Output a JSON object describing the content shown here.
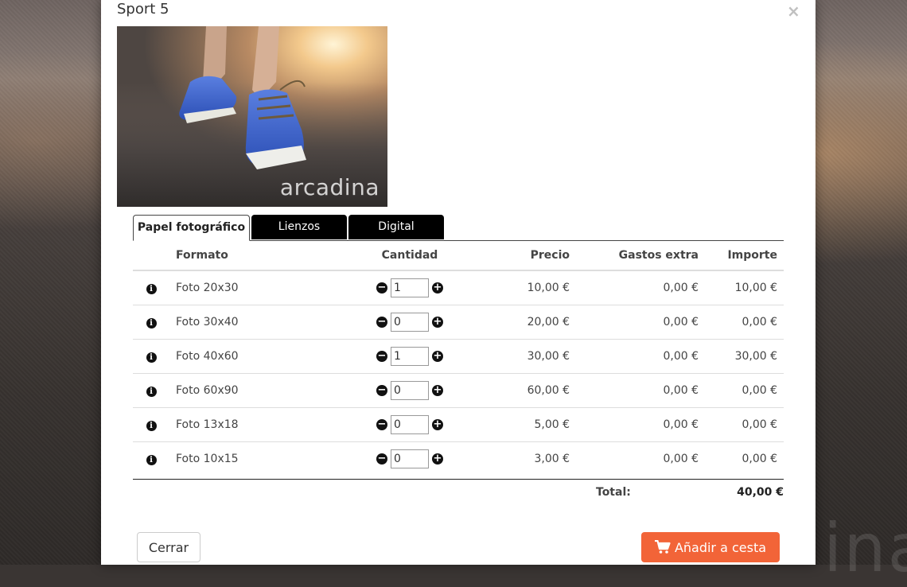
{
  "modal": {
    "title": "Sport 5",
    "close_icon": "close-icon",
    "close_glyph": "×",
    "photo_watermark": "arcadina"
  },
  "tabs": [
    {
      "label": "Papel fotográfico",
      "active": true
    },
    {
      "label": "Lienzos",
      "active": false
    },
    {
      "label": "Digital",
      "active": false
    }
  ],
  "table": {
    "headers": {
      "format": "Formato",
      "quantity": "Cantidad",
      "price": "Precio",
      "extra": "Gastos extra",
      "amount": "Importe"
    },
    "rows": [
      {
        "format": "Foto 20x30",
        "quantity": "1",
        "price": "10,00 €",
        "extra": "0,00 €",
        "amount": "10,00 €"
      },
      {
        "format": "Foto 30x40",
        "quantity": "0",
        "price": "20,00 €",
        "extra": "0,00 €",
        "amount": "0,00 €"
      },
      {
        "format": "Foto 40x60",
        "quantity": "1",
        "price": "30,00 €",
        "extra": "0,00 €",
        "amount": "30,00 €"
      },
      {
        "format": "Foto 60x90",
        "quantity": "0",
        "price": "60,00 €",
        "extra": "0,00 €",
        "amount": "0,00 €"
      },
      {
        "format": "Foto 13x18",
        "quantity": "0",
        "price": "5,00 €",
        "extra": "0,00 €",
        "amount": "0,00 €"
      },
      {
        "format": "Foto 10x15",
        "quantity": "0",
        "price": "3,00 €",
        "extra": "0,00 €",
        "amount": "0,00 €"
      }
    ]
  },
  "icons": {
    "info": "info-icon",
    "minus": "minus-circle-icon",
    "plus": "plus-circle-icon",
    "cart": "shopping-cart-icon"
  },
  "totals": {
    "label": "Total:",
    "value": "40,00 €"
  },
  "footer": {
    "close_label": "Cerrar",
    "add_to_cart_label": "Añadir a cesta"
  },
  "colors": {
    "accent": "#f26438",
    "tab_inactive_bg": "#000000"
  }
}
